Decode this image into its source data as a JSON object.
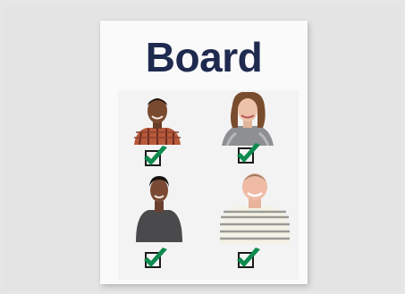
{
  "poster": {
    "title": "Board"
  },
  "colors": {
    "title": "#1f2a4f",
    "check": "#0e8a4f",
    "box": "#1a1a1a"
  },
  "members": [
    {
      "icon": "person-1-photo"
    },
    {
      "icon": "person-2-photo"
    },
    {
      "icon": "person-3-photo"
    },
    {
      "icon": "person-4-photo"
    }
  ]
}
